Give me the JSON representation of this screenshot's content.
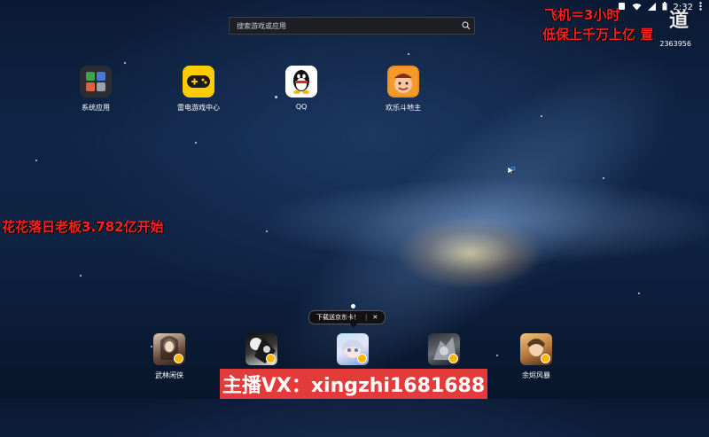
{
  "search": {
    "placeholder": "搜索游戏或应用"
  },
  "status_bar": {
    "time": "2:32"
  },
  "overlays": {
    "flight": "飞机＝3小时",
    "minimum": "低保上千万上亿 置",
    "boss": "花花落日老板3.782亿开始",
    "room_number": "2363956",
    "streamer_vx": "主播VX：xingzhi1681688"
  },
  "logo": {
    "text": "道"
  },
  "desktop_apps": [
    {
      "label": "系统应用",
      "icon": "system-apps-folder-icon"
    },
    {
      "label": "雷电游戏中心",
      "icon": "gamepad-icon"
    },
    {
      "label": "QQ",
      "icon": "qq-penguin-icon"
    },
    {
      "label": "欢乐斗地主",
      "icon": "landlord-game-icon"
    }
  ],
  "tooltip": {
    "text": "下载送京东卡！",
    "close": "✕"
  },
  "dock_apps": [
    {
      "label": "武林闲侠",
      "icon": "game-character-icon"
    },
    {
      "label": "",
      "icon": "game-character-icon"
    },
    {
      "label": "",
      "icon": "game-character-icon"
    },
    {
      "label": "",
      "icon": "game-character-icon"
    },
    {
      "label": "余烬风暴",
      "icon": "game-character-icon"
    }
  ],
  "colors": {
    "overlay_red": "#ff1f1f",
    "banner_red": "#e33a3a",
    "search_bg": "#1c1f24"
  }
}
